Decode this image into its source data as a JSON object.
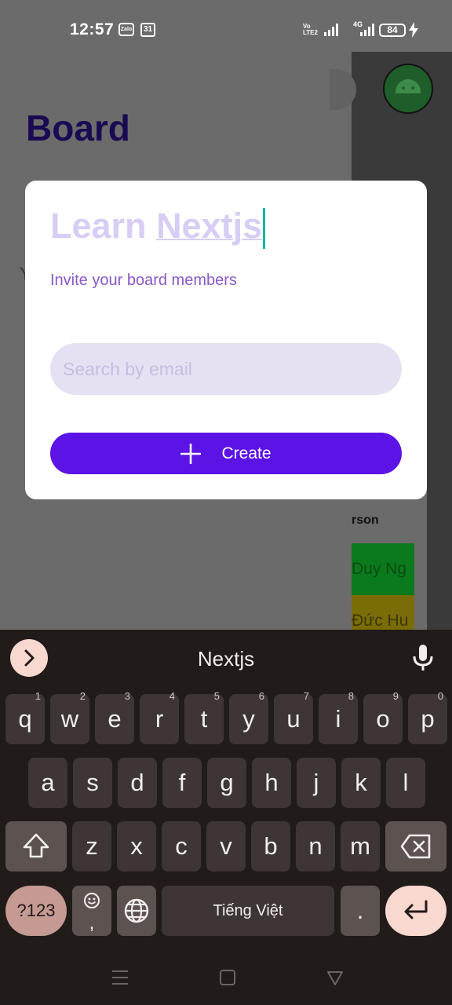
{
  "status_bar": {
    "time": "12:57",
    "zalo": "Zalo",
    "calendar_day": "31",
    "network_tag": "Vo LTE2",
    "network_type": "4G",
    "battery_level": "84"
  },
  "background": {
    "page_title": "Board",
    "partial_text": "Y",
    "column_header": "rson",
    "rows": [
      "Duy Ng",
      "Đức Hu"
    ]
  },
  "dialog": {
    "title_word1": "Learn",
    "title_word2": "Nextjs",
    "subtitle": "Invite your board members",
    "search_placeholder": "Search by email",
    "create_label": "Create"
  },
  "keyboard": {
    "suggestion": "Nextjs",
    "row1": [
      {
        "k": "q",
        "h": "1"
      },
      {
        "k": "w",
        "h": "2"
      },
      {
        "k": "e",
        "h": "3"
      },
      {
        "k": "r",
        "h": "4"
      },
      {
        "k": "t",
        "h": "5"
      },
      {
        "k": "y",
        "h": "6"
      },
      {
        "k": "u",
        "h": "7"
      },
      {
        "k": "i",
        "h": "8"
      },
      {
        "k": "o",
        "h": "9"
      },
      {
        "k": "p",
        "h": "0"
      }
    ],
    "row2": [
      "a",
      "s",
      "d",
      "f",
      "g",
      "h",
      "j",
      "k",
      "l"
    ],
    "row3": [
      "z",
      "x",
      "c",
      "v",
      "b",
      "n",
      "m"
    ],
    "symbols_label": "?123",
    "emoji_comma": ",",
    "space_label": "Tiếng Việt",
    "period": "."
  },
  "colors": {
    "accent": "#5b13e6",
    "title_faded": "#d8cdf4",
    "subtitle": "#8a58c7",
    "search_bg": "#e6e0f3",
    "keyboard_bg": "#211b1a",
    "key_bg": "#3e3634",
    "enter_bg": "#f9d8cf"
  },
  "icons": [
    "plus-icon",
    "chevron-right-icon",
    "microphone-icon",
    "shift-icon",
    "backspace-icon",
    "emoji-icon",
    "globe-icon",
    "enter-icon",
    "nav-menu-icon",
    "nav-home-icon",
    "nav-back-icon"
  ]
}
